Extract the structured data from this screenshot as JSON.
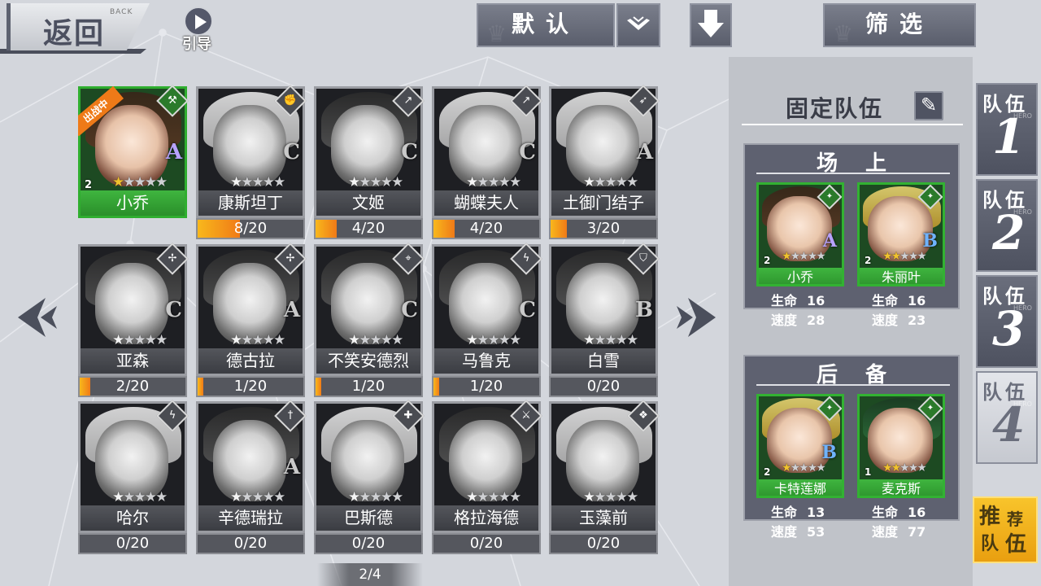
{
  "topbar": {
    "back_label": "返回",
    "back_sub": "BACK",
    "guide_label": "引导",
    "sort_label": "默认",
    "filter_label": "筛选"
  },
  "heroes": [
    {
      "name": "小乔",
      "level": "2",
      "grade": "A",
      "stars": 1,
      "status": "出战中",
      "active": true,
      "icon": "hammer-icon",
      "fragments": ""
    },
    {
      "name": "康斯坦丁",
      "level": "",
      "grade": "C",
      "stars": 1,
      "fragments": "8/20",
      "progress": 0.4,
      "icon": "fist-icon"
    },
    {
      "name": "文姬",
      "level": "",
      "grade": "C",
      "stars": 1,
      "fragments": "4/20",
      "progress": 0.2,
      "icon": "spear-icon"
    },
    {
      "name": "蝴蝶夫人",
      "level": "",
      "grade": "C",
      "stars": 1,
      "fragments": "4/20",
      "progress": 0.2,
      "icon": "spear-icon"
    },
    {
      "name": "土御门结子",
      "level": "",
      "grade": "A",
      "stars": 1,
      "fragments": "3/20",
      "progress": 0.15,
      "icon": "bow-icon"
    },
    {
      "name": "亚森",
      "level": "",
      "grade": "C",
      "stars": 1,
      "fragments": "2/20",
      "progress": 0.1,
      "icon": "shuriken-icon"
    },
    {
      "name": "德古拉",
      "level": "",
      "grade": "A",
      "stars": 1,
      "fragments": "1/20",
      "progress": 0.05,
      "icon": "shuriken-icon"
    },
    {
      "name": "不笑安德烈",
      "level": "",
      "grade": "C",
      "stars": 1,
      "fragments": "1/20",
      "progress": 0.05,
      "icon": "crosshair-icon"
    },
    {
      "name": "马鲁克",
      "level": "",
      "grade": "C",
      "stars": 1,
      "fragments": "1/20",
      "progress": 0.05,
      "icon": "lightning-icon"
    },
    {
      "name": "白雪",
      "level": "",
      "grade": "B",
      "stars": 1,
      "fragments": "0/20",
      "progress": 0,
      "icon": "shield-icon"
    },
    {
      "name": "哈尔",
      "level": "",
      "grade": "",
      "stars": 1,
      "fragments": "0/20",
      "progress": 0,
      "icon": "lightning-icon"
    },
    {
      "name": "辛德瑞拉",
      "level": "",
      "grade": "A",
      "stars": 1,
      "fragments": "0/20",
      "progress": 0,
      "icon": "dagger-icon"
    },
    {
      "name": "巴斯德",
      "level": "",
      "grade": "",
      "stars": 1,
      "fragments": "0/20",
      "progress": 0,
      "icon": "plus-icon"
    },
    {
      "name": "格拉海德",
      "level": "",
      "grade": "",
      "stars": 1,
      "fragments": "0/20",
      "progress": 0,
      "icon": "sword-icon"
    },
    {
      "name": "玉藻前",
      "level": "",
      "grade": "",
      "stars": 1,
      "fragments": "0/20",
      "progress": 0,
      "icon": "fan-icon"
    }
  ],
  "pager": {
    "text": "2/4"
  },
  "team_panel": {
    "title": "固定队伍",
    "field_title": "场上",
    "reserve_title": "后备",
    "stat_hp": "生命",
    "stat_speed": "速度",
    "field": [
      {
        "name": "小乔",
        "level": "2",
        "grade": "A",
        "stars": 1,
        "hp": "16",
        "speed": "28"
      },
      {
        "name": "朱丽叶",
        "level": "2",
        "grade": "B",
        "stars": 2,
        "hp": "16",
        "speed": "23"
      }
    ],
    "reserve": [
      {
        "name": "卡特莲娜",
        "level": "2",
        "grade": "B",
        "stars": 1,
        "hp": "13",
        "speed": "53"
      },
      {
        "name": "麦克斯",
        "level": "1",
        "grade": "",
        "stars": 2,
        "hp": "16",
        "speed": "77"
      }
    ]
  },
  "team_tabs": [
    {
      "label": "队伍",
      "num": "1",
      "hero": "HERO"
    },
    {
      "label": "队伍",
      "num": "2",
      "hero": "HERO"
    },
    {
      "label": "队伍",
      "num": "3",
      "hero": "HERO"
    },
    {
      "label": "队伍",
      "num": "4",
      "hero": "HERO",
      "selected": true
    }
  ],
  "recommend": {
    "a": "推",
    "b": "荐",
    "c": "队",
    "d": "伍"
  },
  "colors": {
    "active_green": "#2fae2f",
    "fragment_orange": "#f07a17",
    "recommend_gold": "#f8c42b"
  }
}
